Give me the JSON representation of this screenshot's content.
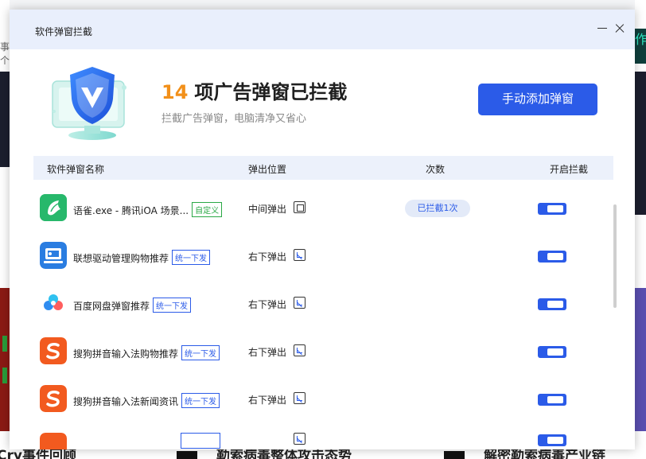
{
  "background": {
    "left_fragment": "事个",
    "right_fragment": "作",
    "bottom_texts": [
      "Cry事件回顾",
      "勒索病毒整体攻击态势",
      "解密勒索病毒产业链"
    ]
  },
  "window": {
    "title": "软件弹窗拦截"
  },
  "header": {
    "count": "14",
    "headline": "项广告弹窗已拦截",
    "subline": "拦截广告弹窗，电脑清净又省心",
    "add_button": "手动添加弹窗"
  },
  "table": {
    "columns": [
      "软件弹窗名称",
      "弹出位置",
      "次数",
      "开启拦截"
    ],
    "rows": [
      {
        "name": "语雀.exe - 腾讯iOA 场景...",
        "tag": "自定义",
        "tag_color": "green",
        "position": "中间弹出",
        "position_icon": "center-popup-icon",
        "count": "已拦截1次",
        "enabled": true,
        "icon": "yuque-app-icon"
      },
      {
        "name": "联想驱动管理购物推荐",
        "tag": "统一下发",
        "tag_color": "blue",
        "position": "右下弹出",
        "position_icon": "bottom-right-popup-icon",
        "count": "",
        "enabled": true,
        "icon": "lenovo-app-icon"
      },
      {
        "name": "百度网盘弹窗推荐",
        "tag": "统一下发",
        "tag_color": "blue",
        "position": "右下弹出",
        "position_icon": "bottom-right-popup-icon",
        "count": "",
        "enabled": true,
        "icon": "baidu-netdisk-icon"
      },
      {
        "name": "搜狗拼音输入法购物推荐",
        "tag": "统一下发",
        "tag_color": "blue",
        "position": "右下弹出",
        "position_icon": "bottom-right-popup-icon",
        "count": "",
        "enabled": true,
        "icon": "sogou-pinyin-icon"
      },
      {
        "name": "搜狗拼音输入法新闻资讯",
        "tag": "统一下发",
        "tag_color": "blue",
        "position": "右下弹出",
        "position_icon": "bottom-right-popup-icon",
        "count": "",
        "enabled": true,
        "icon": "sogou-pinyin-icon"
      }
    ]
  },
  "colors": {
    "accent": "#2b5be8",
    "count_highlight": "#f2901a",
    "title_bar": "#e9effc",
    "tag_green": "#2aa845"
  }
}
